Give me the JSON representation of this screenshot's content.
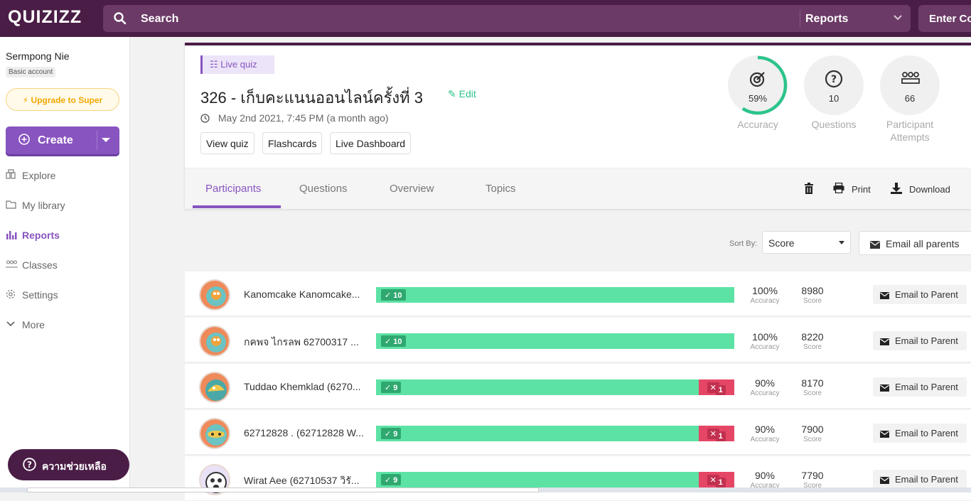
{
  "topbar": {
    "logo": "QUIZIZZ",
    "search_placeholder": "Search",
    "reports_label": "Reports",
    "enter_code_label": "Enter Code"
  },
  "sidebar": {
    "user_name": "Sermpong Nie",
    "account_type": "Basic account",
    "upgrade_label": "Upgrade to Super",
    "create_label": "Create",
    "items": [
      {
        "label": "Explore",
        "icon": "explore-icon"
      },
      {
        "label": "My library",
        "icon": "folder-icon"
      },
      {
        "label": "Reports",
        "icon": "reports-icon",
        "active": true
      },
      {
        "label": "Classes",
        "icon": "classes-icon"
      },
      {
        "label": "Settings",
        "icon": "gear-icon"
      },
      {
        "label": "More",
        "icon": "chevron-down-icon"
      }
    ],
    "help_label": "ความช่วยเหลือ"
  },
  "report": {
    "badge": "Live quiz",
    "title": "326 - เก็บคะแนนออนไลน์ครั้งที่ 3",
    "edit_label": "Edit",
    "date": "May 2nd 2021, 7:45 PM (a month ago)",
    "buttons": [
      "View quiz",
      "Flashcards",
      "Live Dashboard"
    ],
    "stats": {
      "accuracy_value": "59%",
      "accuracy_fraction": 0.59,
      "accuracy_label": "Accuracy",
      "questions_value": "10",
      "questions_label": "Questions",
      "attempts_value": "66",
      "attempts_label_1": "Participant",
      "attempts_label_2": "Attempts"
    },
    "tabs": [
      "Participants",
      "Questions",
      "Overview",
      "Topics"
    ],
    "active_tab": "Participants",
    "print_label": "Print",
    "download_label": "Download"
  },
  "sort": {
    "label": "Sort By:",
    "value": "Score",
    "email_all_label": "Email all parents"
  },
  "participants": [
    {
      "name": "Kanomcake Kanomcake...",
      "correct": "10",
      "incorrect": "",
      "correct_count": 10,
      "incorrect_count": 0,
      "accuracy": "100%",
      "score": "8980"
    },
    {
      "name": "กคพจ ไกรลพ 62700317 ...",
      "correct": "10",
      "incorrect": "",
      "correct_count": 10,
      "incorrect_count": 0,
      "accuracy": "100%",
      "score": "8220"
    },
    {
      "name": "Tuddao Khemklad (6270...",
      "correct": "9",
      "incorrect": "1",
      "correct_count": 9,
      "incorrect_count": 1,
      "accuracy": "90%",
      "score": "8170"
    },
    {
      "name": "62712828 . (62712828 W...",
      "correct": "9",
      "incorrect": "1",
      "correct_count": 9,
      "incorrect_count": 1,
      "accuracy": "90%",
      "score": "7900"
    },
    {
      "name": "Wirat Aee (62710537 วิรั...",
      "correct": "9",
      "incorrect": "1",
      "correct_count": 9,
      "incorrect_count": 1,
      "accuracy": "90%",
      "score": "7790"
    }
  ],
  "row_labels": {
    "accuracy_caption": "Accuracy",
    "score_caption": "Score",
    "email_parent": "Email to Parent"
  },
  "colors": {
    "brand_dark": "#4a1d46",
    "brand_purple": "#8854c0",
    "correct_green": "#5de2a5",
    "incorrect_red": "#e54665"
  }
}
